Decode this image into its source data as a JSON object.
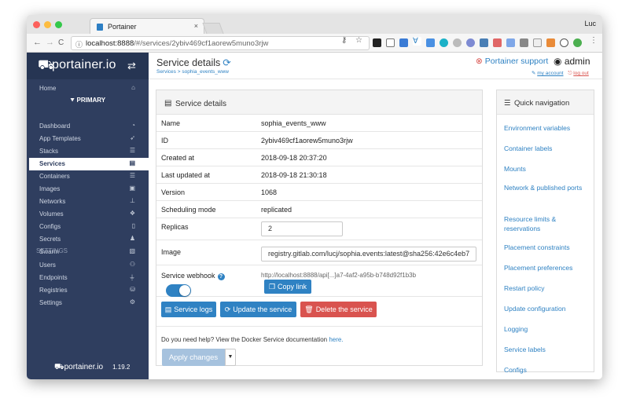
{
  "browser": {
    "tab_title": "Portainer",
    "tab_close": "×",
    "user": "Luc",
    "url_host": "localhost:8888",
    "url_rest": "/#/services/2ybiv469cf1aorew5muno3rjw",
    "info_glyph": "ⓘ",
    "nav": {
      "back": "←",
      "forward": "→",
      "reload": "C"
    }
  },
  "sidebar": {
    "brand": "portainer.io",
    "toggle_glyph": "⇄",
    "home": "Home",
    "env": "PRIMARY",
    "items": [
      {
        "label": "Dashboard",
        "icon": "tachometer-icon",
        "glyph": "◔"
      },
      {
        "label": "App Templates",
        "icon": "rocket-icon",
        "glyph": "➶"
      },
      {
        "label": "Stacks",
        "icon": "th-list-icon",
        "glyph": "☰"
      },
      {
        "label": "Services",
        "icon": "list-alt-icon",
        "glyph": "▤"
      },
      {
        "label": "Containers",
        "icon": "server-icon",
        "glyph": "☰"
      },
      {
        "label": "Images",
        "icon": "clone-icon",
        "glyph": "▣"
      },
      {
        "label": "Networks",
        "icon": "sitemap-icon",
        "glyph": "⊥"
      },
      {
        "label": "Volumes",
        "icon": "cubes-icon",
        "glyph": "❖"
      },
      {
        "label": "Configs",
        "icon": "file-code-icon",
        "glyph": "▯"
      },
      {
        "label": "Secrets",
        "icon": "user-secret-icon",
        "glyph": "♟"
      },
      {
        "label": "Swarm",
        "icon": "object-group-icon",
        "glyph": "▧"
      }
    ],
    "settings_header": "SETTINGS",
    "settings_items": [
      {
        "label": "Users",
        "icon": "users-icon",
        "glyph": "⚇"
      },
      {
        "label": "Endpoints",
        "icon": "plug-icon",
        "glyph": "⏚"
      },
      {
        "label": "Registries",
        "icon": "database-icon",
        "glyph": "⛁"
      },
      {
        "label": "Settings",
        "icon": "cogs-icon",
        "glyph": "⚙"
      }
    ],
    "footer_brand": "portainer.io",
    "version": "1.19.2"
  },
  "header": {
    "title": "Service details",
    "breadcrumb": "Services > sophia_events_www",
    "support": "Portainer support",
    "admin": "admin",
    "my_account": "my account",
    "logout": "log out"
  },
  "details": {
    "panel_title": "Service details",
    "name_label": "Name",
    "name": "sophia_events_www",
    "id_label": "ID",
    "id": "2ybiv469cf1aorew5muno3rjw",
    "created_label": "Created at",
    "created": "2018-09-18 20:37:20",
    "updated_label": "Last updated at",
    "updated": "2018-09-18 21:30:18",
    "version_label": "Version",
    "version": "1068",
    "mode_label": "Scheduling mode",
    "mode": "replicated",
    "replicas_label": "Replicas",
    "replicas": "2",
    "image_label": "Image",
    "image": "registry.gitlab.com/lucj/sophia.events:latest@sha256:42e6c4eb7",
    "webhook_label": "Service webhook",
    "webhook_url": "http://localhost:8888/api[...]a7-4af2-a95b-b748d92f1b3b",
    "webhook_enabled": true,
    "copy_link": "Copy link",
    "service_logs": "Service logs",
    "update": "Update the service",
    "delete": "Delete the service",
    "help_text": "Do you need help? View the Docker Service documentation ",
    "help_link": "here.",
    "apply": "Apply changes"
  },
  "quicknav": {
    "title": "Quick navigation",
    "links": [
      "Environment variables",
      "Container labels",
      "Mounts",
      "Network & published ports",
      "Resource limits & reservations",
      "Placement constraints",
      "Placement preferences",
      "Restart policy",
      "Update configuration",
      "Logging",
      "Service labels",
      "Configs"
    ]
  },
  "colors": {
    "sidebar": "#2f3e5f",
    "primary": "#2f82c3",
    "danger": "#d9534f"
  }
}
